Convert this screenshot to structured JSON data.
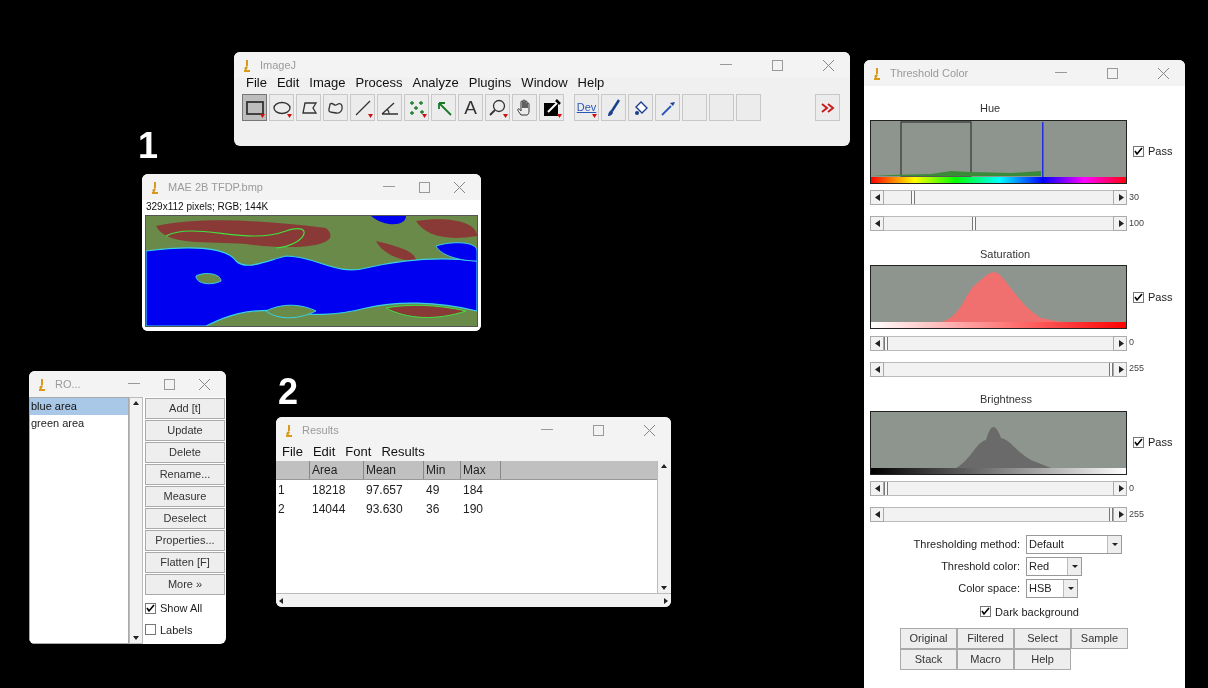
{
  "annotations": [
    {
      "text": "1"
    },
    {
      "text": "2"
    }
  ],
  "imagej": {
    "title": "ImageJ",
    "menu": [
      "File",
      "Edit",
      "Image",
      "Process",
      "Analyze",
      "Plugins",
      "Window",
      "Help"
    ],
    "tools": [
      {
        "kind": "rectangle",
        "selected": true
      },
      {
        "kind": "oval",
        "selected": false
      },
      {
        "kind": "polygon",
        "selected": false
      },
      {
        "kind": "freehand",
        "selected": false
      },
      {
        "kind": "line",
        "selected": false
      },
      {
        "kind": "angle",
        "selected": false
      },
      {
        "kind": "multipoint",
        "selected": false
      },
      {
        "kind": "wand",
        "selected": false
      },
      {
        "kind": "text",
        "label": "A",
        "selected": false
      },
      {
        "kind": "magnifier",
        "selected": false
      },
      {
        "kind": "hand",
        "selected": false
      },
      {
        "kind": "dropper",
        "selected": false
      },
      {
        "kind": "dev",
        "label": "Dev",
        "selected": false
      },
      {
        "kind": "brush",
        "selected": false
      },
      {
        "kind": "bucket",
        "selected": false
      },
      {
        "kind": "pipette",
        "selected": false
      },
      {
        "kind": "empty",
        "selected": false
      },
      {
        "kind": "empty",
        "selected": false
      },
      {
        "kind": "empty",
        "selected": false
      },
      {
        "kind": "more",
        "selected": false
      }
    ]
  },
  "image_window": {
    "title": "MAE 2B TFDP.bmp",
    "info": "329x112 pixels; RGB; 144K"
  },
  "roi_manager": {
    "title": "RO...",
    "items": [
      {
        "label": "blue area",
        "selected": true
      },
      {
        "label": "green area",
        "selected": false
      }
    ],
    "buttons": [
      "Add [t]",
      "Update",
      "Delete",
      "Rename...",
      "Measure",
      "Deselect",
      "Properties...",
      "Flatten [F]",
      "More »"
    ],
    "checkboxes": [
      {
        "label": "Show All",
        "checked": true
      },
      {
        "label": "Labels",
        "checked": false
      }
    ]
  },
  "results": {
    "title": "Results",
    "menu": [
      "File",
      "Edit",
      "Font",
      "Results"
    ],
    "columns": [
      "",
      "Area",
      "Mean",
      "Min",
      "Max"
    ],
    "rows": [
      [
        "1",
        "18218",
        "97.657",
        "49",
        "184"
      ],
      [
        "2",
        "14044",
        "93.630",
        "36",
        "190"
      ]
    ]
  },
  "threshold": {
    "title": "Threshold Color",
    "sections": [
      {
        "kind": "hue",
        "label": "Hue",
        "pass": true,
        "pass_label": "Pass",
        "sliders": [
          {
            "level": 0.12,
            "reading": "30"
          },
          {
            "level": 0.39,
            "reading": "100"
          }
        ]
      },
      {
        "kind": "saturation",
        "label": "Saturation",
        "pass": true,
        "pass_label": "Pass",
        "sliders": [
          {
            "level": 0,
            "reading": "0"
          },
          {
            "level": 1,
            "reading": "255"
          }
        ]
      },
      {
        "kind": "brightness",
        "label": "Brightness",
        "pass": true,
        "pass_label": "Pass",
        "sliders": [
          {
            "level": 0,
            "reading": "0"
          },
          {
            "level": 1,
            "reading": "255"
          }
        ]
      }
    ],
    "dropdowns": [
      {
        "label": "Thresholding method:",
        "value": "Default"
      },
      {
        "label": "Threshold color:",
        "value": "Red"
      },
      {
        "label": "Color space:",
        "value": "HSB"
      }
    ],
    "dark_background": {
      "label": "Dark background",
      "checked": true
    },
    "buttons": [
      [
        "Original",
        "Filtered",
        "Select",
        "Sample"
      ],
      [
        "Stack",
        "Macro",
        "Help"
      ]
    ]
  }
}
